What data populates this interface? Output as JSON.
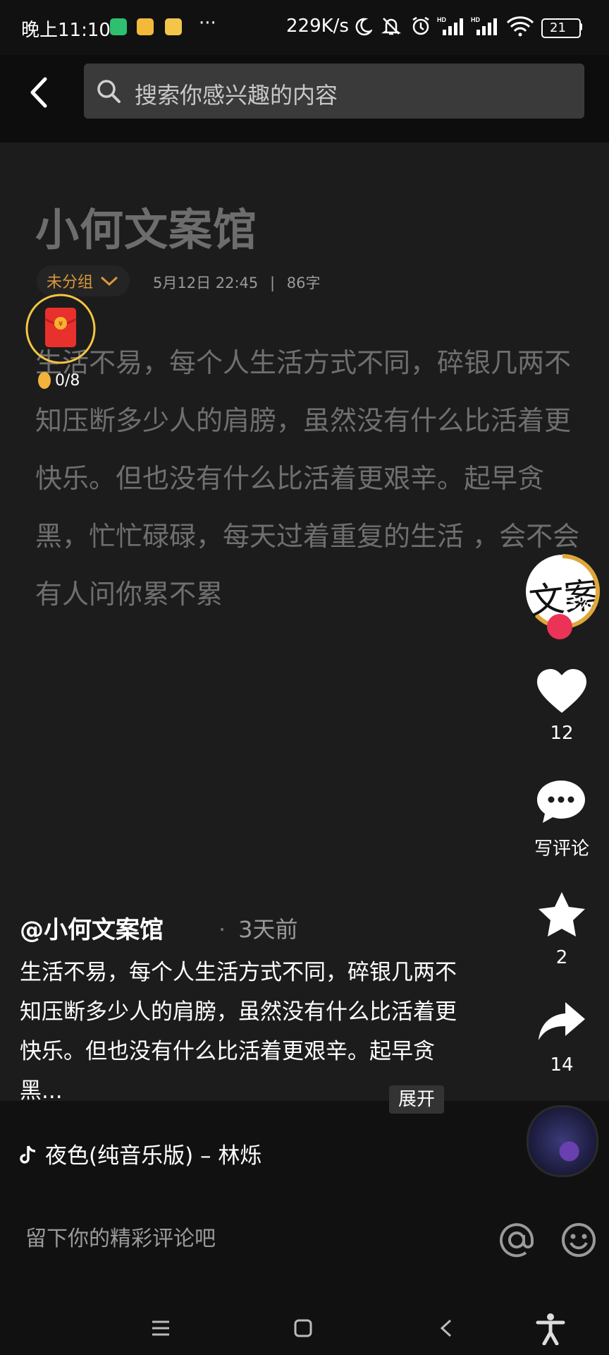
{
  "status_bar": {
    "time": "晚上11:10",
    "more": "···",
    "network_speed": "229K/s",
    "battery": "21",
    "icons": [
      "vpn-shield-icon",
      "app-icon",
      "app-icon",
      "moon-icon",
      "bell-off-icon",
      "alarm-icon",
      "signal-icon",
      "signal-icon",
      "wifi-icon",
      "battery-icon"
    ]
  },
  "header": {
    "back_icon": "chevron-left-icon",
    "search_placeholder": "搜索你感兴趣的内容"
  },
  "document": {
    "title": "小何文案馆",
    "group": "未分组",
    "date": "5月12日 22:45",
    "separator": "|",
    "word_count": "86字",
    "body": "生活不易，每个人生活方式不同，碎银几两不知压断多少人的肩膀，虽然没有什么比活着更快乐。但也没有什么比活着更艰辛。起早贪黑，忙忙碌碌，每天过着重复的生活 ，会不会有人问你累不累"
  },
  "red_packet": {
    "count": "0/8",
    "progress": 0.0
  },
  "rail": {
    "avatar_text": "文案",
    "avatar_progress": "63%",
    "like_count": "12",
    "comment_label": "写评论",
    "favorite_count": "2",
    "share_count": "14"
  },
  "caption": {
    "author": "@小何文案馆",
    "dot": "·",
    "time": "3天前",
    "text": "生活不易，每个人生活方式不同，碎银几两不知压断多少人的肩膀，虽然没有什么比活着更快乐。但也没有什么比活着更艰辛。起早贪黑...",
    "expand": "展开"
  },
  "music": {
    "title": "夜色(纯音乐版) – 林烁"
  },
  "comment_bar": {
    "placeholder": "留下你的精彩评论吧"
  },
  "colors": {
    "accent_red": "#ea3356",
    "group_orange": "#d79a3b",
    "ring_yellow": "#f5c542"
  }
}
